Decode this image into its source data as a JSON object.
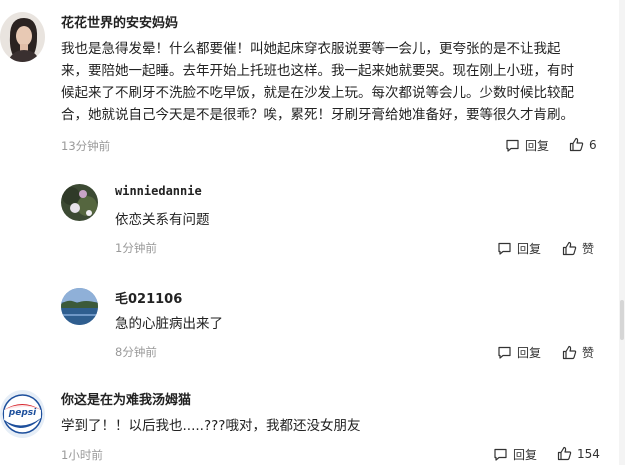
{
  "comments": [
    {
      "author": "花花世界的安安妈妈",
      "lines": [
        "我也是急得发晕！什么都要催！叫她起床穿衣服说要等一会儿，更夸张的是不让我起",
        "来，要陪她一起睡。去年开始上托班也这样。我一起来她就要哭。现在刚上小班，有时",
        "候起来了不刷牙不洗脸不吃早饭，就是在沙发上玩。每次都说等会儿。少数时候比较配",
        "合，她就说自己今天是不是很乖？唉，累死！牙刷牙膏给她准备好，要等很久才肯刷。"
      ],
      "time": "13分钟前",
      "reply_label": "回复",
      "like_count": "6",
      "avatar_icon": "woman-portrait-avatar"
    },
    {
      "author": "winniedannie",
      "text": "依恋关系有问题",
      "time": "1分钟前",
      "reply_label": "回复",
      "like_count": "赞",
      "avatar_icon": "flower-photo-avatar"
    },
    {
      "author": "毛021106",
      "text": "急的心脏病出来了",
      "time": "8分钟前",
      "reply_label": "回复",
      "like_count": "赞",
      "avatar_icon": "lake-landscape-avatar"
    },
    {
      "author": "你这是在为难我汤姆猫",
      "text": "学到了！！以后我也.....???哦对，我都还没女朋友",
      "time": "1小时前",
      "reply_label": "回复",
      "like_count": "154",
      "avatar_icon": "pepsi-logo-avatar",
      "avatar_text": "pepsi"
    }
  ]
}
